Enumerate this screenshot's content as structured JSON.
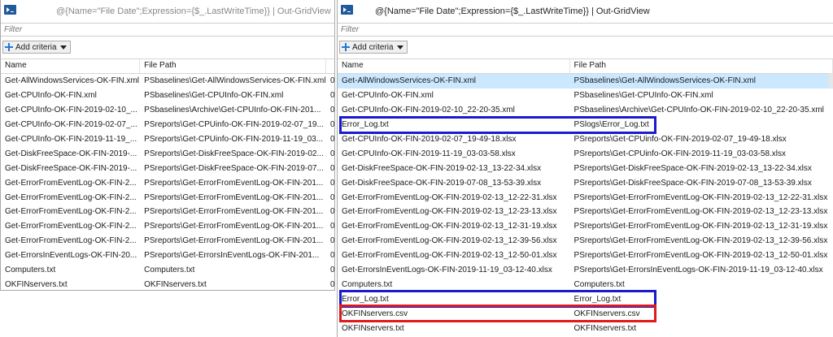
{
  "left_window": {
    "title": "@{Name=\"File Date\";Expression={$_.LastWriteTime}} | Out-GridView",
    "filter_placeholder": "Filter",
    "add_criteria_label": "Add criteria",
    "columns": [
      "Name",
      "File Path"
    ],
    "rows": [
      {
        "name": "Get-AllWindowsServices-OK-FIN.xml",
        "path": "PSbaselines\\Get-AllWindowsServices-OK-FIN.xml",
        "extra": "0"
      },
      {
        "name": "Get-CPUInfo-OK-FIN.xml",
        "path": "PSbaselines\\Get-CPUInfo-OK-FIN.xml",
        "extra": "0"
      },
      {
        "name": "Get-CPUInfo-OK-FIN-2019-02-10_...",
        "path": "PSbaselines\\Archive\\Get-CPUInfo-OK-FIN-201...",
        "extra": "0"
      },
      {
        "name": "Get-CPUInfo-OK-FIN-2019-02-07_...",
        "path": "PSreports\\Get-CPUinfo-OK-FIN-2019-02-07_19...",
        "extra": "0"
      },
      {
        "name": "Get-CPUInfo-OK-FIN-2019-11-19_...",
        "path": "PSreports\\Get-CPUinfo-OK-FIN-2019-11-19_03...",
        "extra": "0"
      },
      {
        "name": "Get-DiskFreeSpace-OK-FIN-2019-...",
        "path": "PSreports\\Get-DiskFreeSpace-OK-FIN-2019-02...",
        "extra": "0"
      },
      {
        "name": "Get-DiskFreeSpace-OK-FIN-2019-...",
        "path": "PSreports\\Get-DiskFreeSpace-OK-FIN-2019-07...",
        "extra": "0"
      },
      {
        "name": "Get-ErrorFromEventLog-OK-FIN-2...",
        "path": "PSreports\\Get-ErrorFromEventLog-OK-FIN-201...",
        "extra": "0"
      },
      {
        "name": "Get-ErrorFromEventLog-OK-FIN-2...",
        "path": "PSreports\\Get-ErrorFromEventLog-OK-FIN-201...",
        "extra": "0"
      },
      {
        "name": "Get-ErrorFromEventLog-OK-FIN-2...",
        "path": "PSreports\\Get-ErrorFromEventLog-OK-FIN-201...",
        "extra": "0"
      },
      {
        "name": "Get-ErrorFromEventLog-OK-FIN-2...",
        "path": "PSreports\\Get-ErrorFromEventLog-OK-FIN-201...",
        "extra": "0"
      },
      {
        "name": "Get-ErrorFromEventLog-OK-FIN-2...",
        "path": "PSreports\\Get-ErrorFromEventLog-OK-FIN-201...",
        "extra": "0"
      },
      {
        "name": "Get-ErrorsInEventLogs-OK-FIN-20...",
        "path": "PSreports\\Get-ErrorsInEventLogs-OK-FIN-201...",
        "extra": "0"
      },
      {
        "name": "Computers.txt",
        "path": "Computers.txt",
        "extra": "0"
      },
      {
        "name": "OKFINservers.txt",
        "path": "OKFINservers.txt",
        "extra": "0"
      }
    ]
  },
  "right_window": {
    "title": "@{Name=\"File Date\";Expression={$_.LastWriteTime}} | Out-GridView",
    "filter_placeholder": "Filter",
    "add_criteria_label": "Add criteria",
    "columns": [
      "Name",
      "File Path"
    ],
    "rows": [
      {
        "name": "Get-AllWindowsServices-OK-FIN.xml",
        "path": "PSbaselines\\Get-AllWindowsServices-OK-FIN.xml",
        "selected": true
      },
      {
        "name": "Get-CPUInfo-OK-FIN.xml",
        "path": "PSbaselines\\Get-CPUInfo-OK-FIN.xml"
      },
      {
        "name": "Get-CPUInfo-OK-FIN-2019-02-10_22-20-35.xml",
        "path": "PSbaselines\\Archive\\Get-CPUInfo-OK-FIN-2019-02-10_22-20-35.xml"
      },
      {
        "name": "Error_Log.txt",
        "path": "PSlogs\\Error_Log.txt",
        "highlight": "blue"
      },
      {
        "name": "Get-CPUInfo-OK-FIN-2019-02-07_19-49-18.xlsx",
        "path": "PSreports\\Get-CPUinfo-OK-FIN-2019-02-07_19-49-18.xlsx"
      },
      {
        "name": "Get-CPUInfo-OK-FIN-2019-11-19_03-03-58.xlsx",
        "path": "PSreports\\Get-CPUinfo-OK-FIN-2019-11-19_03-03-58.xlsx"
      },
      {
        "name": "Get-DiskFreeSpace-OK-FIN-2019-02-13_13-22-34.xlsx",
        "path": "PSreports\\Get-DiskFreeSpace-OK-FIN-2019-02-13_13-22-34.xlsx"
      },
      {
        "name": "Get-DiskFreeSpace-OK-FIN-2019-07-08_13-53-39.xlsx",
        "path": "PSreports\\Get-DiskFreeSpace-OK-FIN-2019-07-08_13-53-39.xlsx"
      },
      {
        "name": "Get-ErrorFromEventLog-OK-FIN-2019-02-13_12-22-31.xlsx",
        "path": "PSreports\\Get-ErrorFromEventLog-OK-FIN-2019-02-13_12-22-31.xlsx"
      },
      {
        "name": "Get-ErrorFromEventLog-OK-FIN-2019-02-13_12-23-13.xlsx",
        "path": "PSreports\\Get-ErrorFromEventLog-OK-FIN-2019-02-13_12-23-13.xlsx"
      },
      {
        "name": "Get-ErrorFromEventLog-OK-FIN-2019-02-13_12-31-19.xlsx",
        "path": "PSreports\\Get-ErrorFromEventLog-OK-FIN-2019-02-13_12-31-19.xlsx"
      },
      {
        "name": "Get-ErrorFromEventLog-OK-FIN-2019-02-13_12-39-56.xlsx",
        "path": "PSreports\\Get-ErrorFromEventLog-OK-FIN-2019-02-13_12-39-56.xlsx"
      },
      {
        "name": "Get-ErrorFromEventLog-OK-FIN-2019-02-13_12-50-01.xlsx",
        "path": "PSreports\\Get-ErrorFromEventLog-OK-FIN-2019-02-13_12-50-01.xlsx"
      },
      {
        "name": "Get-ErrorsInEventLogs-OK-FIN-2019-11-19_03-12-40.xlsx",
        "path": "PSreports\\Get-ErrorsInEventLogs-OK-FIN-2019-11-19_03-12-40.xlsx"
      },
      {
        "name": "Computers.txt",
        "path": "Computers.txt"
      },
      {
        "name": "Error_Log.txt",
        "path": "Error_Log.txt",
        "highlight": "blue"
      },
      {
        "name": "OKFINservers.csv",
        "path": "OKFINservers.csv",
        "highlight": "red"
      },
      {
        "name": "OKFINservers.txt",
        "path": "OKFINservers.txt"
      }
    ]
  },
  "colors": {
    "selection": "#cce8ff",
    "highlight_blue": "#1a1ad0",
    "highlight_red": "#e01a1a",
    "icon_blue": "#1e5a9c",
    "plus_blue": "#1f7ad8"
  },
  "icons": [
    "powershell-icon",
    "plus-icon",
    "dropdown-arrow-icon"
  ]
}
